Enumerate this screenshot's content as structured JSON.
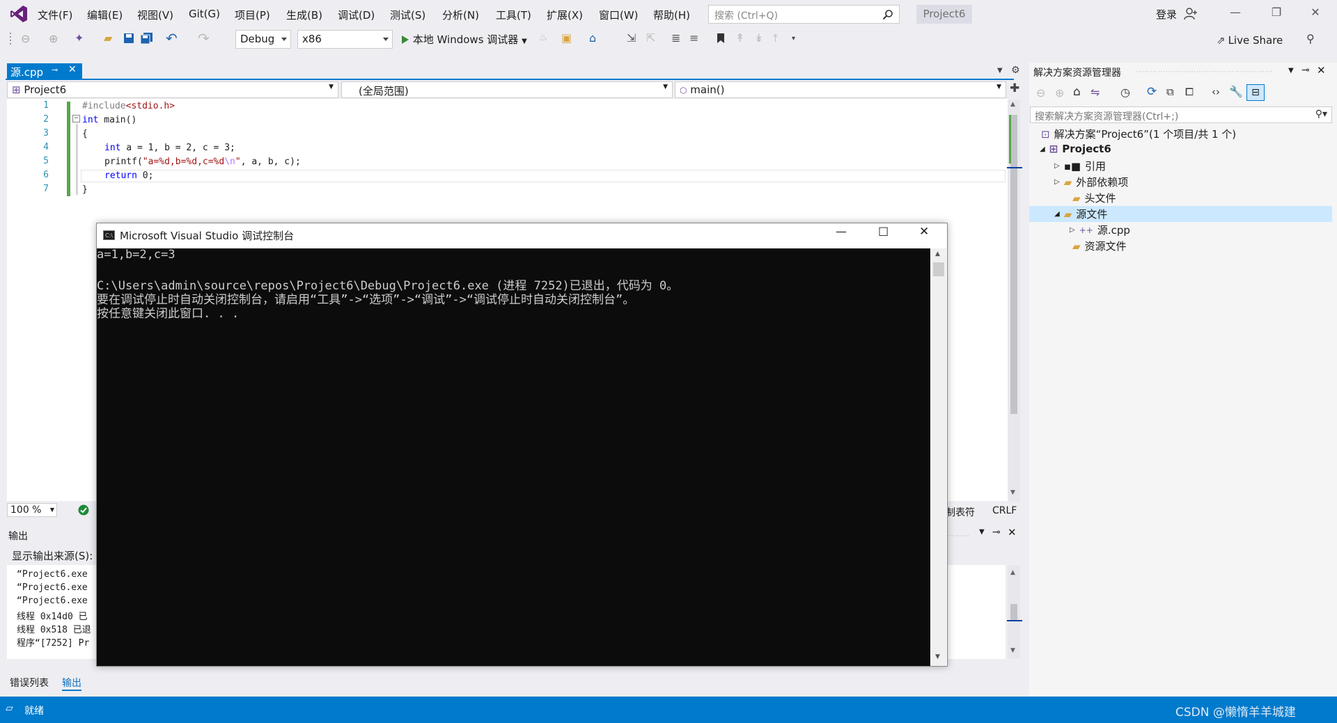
{
  "menu": [
    "文件(F)",
    "编辑(E)",
    "视图(V)",
    "Git(G)",
    "项目(P)",
    "生成(B)",
    "调试(D)",
    "测试(S)",
    "分析(N)",
    "工具(T)",
    "扩展(X)",
    "窗口(W)",
    "帮助(H)"
  ],
  "search": {
    "placeholder": "搜索 (Ctrl+Q)"
  },
  "project_badge": "Project6",
  "login": "登录",
  "toolbar": {
    "config": "Debug",
    "platform": "x86",
    "run_label": "本地 Windows 调试器",
    "live_share": "Live Share"
  },
  "editor": {
    "tab": "源.cpp",
    "nav": {
      "project": "Project6",
      "scope": "(全局范围)",
      "member": "main()"
    },
    "line_numbers": [
      "1",
      "2",
      "3",
      "4",
      "5",
      "6",
      "7"
    ],
    "code": {
      "l1a": "#include",
      "l1b": "<stdio.h>",
      "l2a": "int",
      "l2b": " main()",
      "l3": "{",
      "l4a": "int",
      "l4b": " a = 1, b = 2, c = 3;",
      "l5a": "printf(",
      "l5b": "\"a=%d,b=%d,c=%d",
      "l5c": "\\n",
      "l5d": "\"",
      "l5e": ", a, b, c);",
      "l6a": "return",
      "l6b": " 0;",
      "l7": "}"
    },
    "zoom": "100 %",
    "encoding_tail": "制表符",
    "line_ending": "CRLF"
  },
  "output": {
    "title": "输出",
    "source_label": "显示输出来源(S):",
    "lines": [
      "“Project6.exe",
      "“Project6.exe",
      "“Project6.exe",
      "线程 0x14d0 已",
      "线程 0x518 已退",
      "程序“[7252] Pr"
    ]
  },
  "bottom_tabs": [
    "错误列表",
    "输出"
  ],
  "status": {
    "ready": "就绪",
    "watermark": "CSDN @懒惰羊羊城建"
  },
  "solution_explorer": {
    "title": "解决方案资源管理器",
    "search_placeholder": "搜索解决方案资源管理器(Ctrl+;)",
    "solution": "解决方案“Project6”(1 个项目/共 1 个)",
    "project": "Project6",
    "items": [
      "引用",
      "外部依赖项",
      "头文件",
      "源文件",
      "源.cpp",
      "资源文件"
    ]
  },
  "console": {
    "title": "Microsoft Visual Studio 调试控制台",
    "lines": [
      "a=1,b=2,c=3",
      "",
      "C:\\Users\\admin\\source\\repos\\Project6\\Debug\\Project6.exe (进程 7252)已退出，代码为 0。",
      "要在调试停止时自动关闭控制台，请启用“工具”->“选项”->“调试”->“调试停止时自动关闭控制台”。",
      "按任意键关闭此窗口. . ."
    ]
  }
}
